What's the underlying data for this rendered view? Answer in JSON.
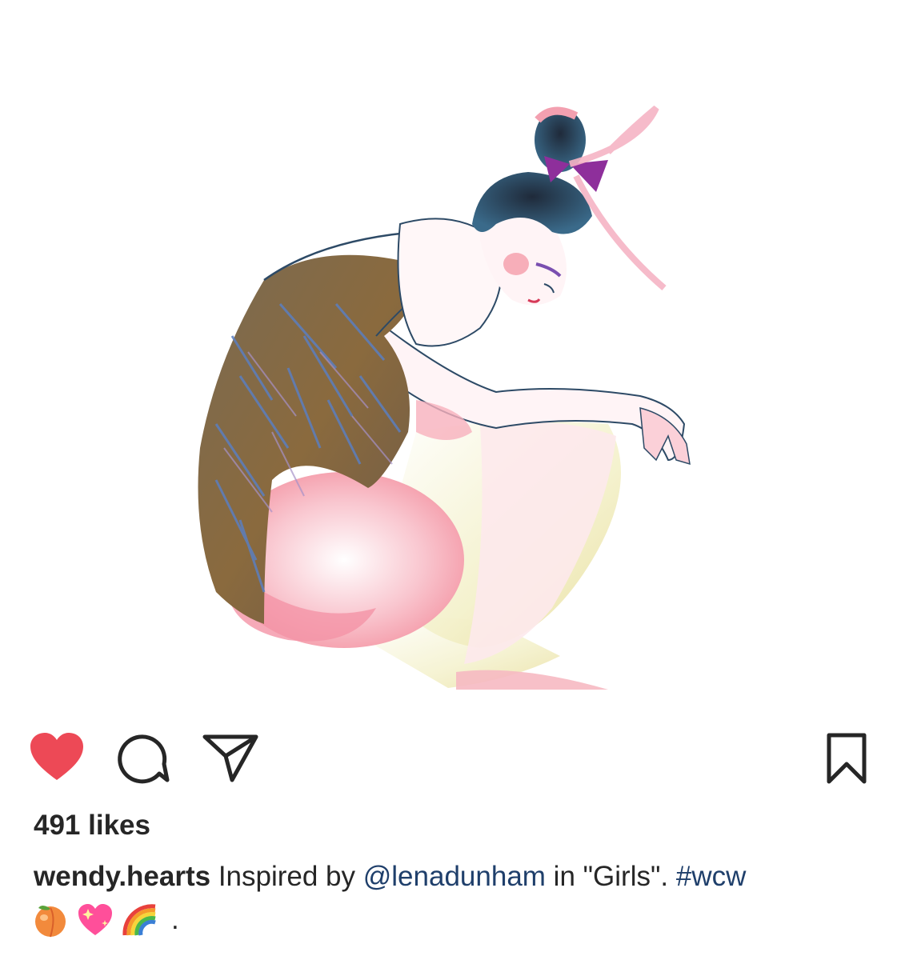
{
  "post": {
    "likes_text": "491 likes",
    "caption": {
      "username": "wendy.hearts",
      "text_before_mention": " Inspired by ",
      "mention": "@lenadunham",
      "text_after_mention": " in \"Girls\". ",
      "hashtag": "#wcw",
      "emoji_icons": [
        "peach-emoji",
        "sparkling-heart-emoji",
        "rainbow-emoji"
      ],
      "trailing_text": "."
    },
    "liked": true
  },
  "actions": {
    "icons": [
      "heart-icon",
      "comment-icon",
      "share-icon",
      "bookmark-icon"
    ]
  },
  "colors": {
    "heart": "#ed4956",
    "link": "#1f3f6b",
    "text": "#262626"
  }
}
